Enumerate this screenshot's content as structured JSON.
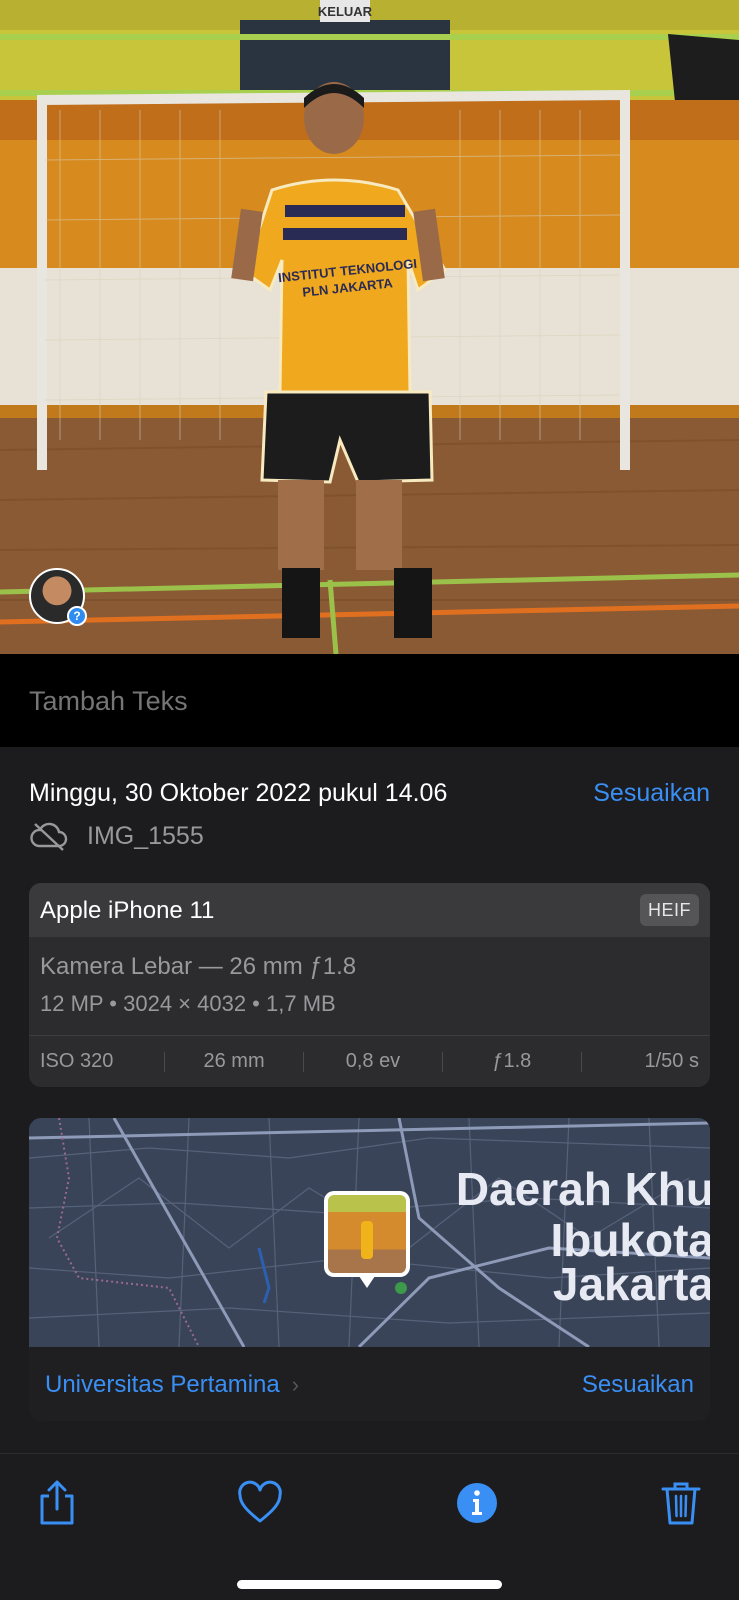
{
  "photo": {
    "exit_sign": "KELUAR",
    "face_badge_icon": "person-face-icon",
    "face_badge_mark": "?"
  },
  "caption": {
    "placeholder": "Tambah Teks"
  },
  "info": {
    "date": "Minggu, 30 Oktober 2022 pukul 14.06",
    "adjust_label": "Sesuaikan",
    "file_name": "IMG_1555",
    "cloud_icon": "icloud-off-icon"
  },
  "camera": {
    "model": "Apple iPhone 11",
    "format": "HEIF",
    "lens": "Kamera Lebar — 26 mm ƒ1.8",
    "specs": "12 MP  •  3024 × 4032  •  1,7 MB",
    "exif": {
      "iso": "ISO 320",
      "focal": "26 mm",
      "ev": "0,8 ev",
      "aperture": "ƒ1.8",
      "shutter": "1/50 s"
    }
  },
  "map": {
    "region_line1": "Daerah Khu",
    "region_line2": "Ibukota",
    "region_line3": "Jakarta",
    "place": "Universitas Pertamina",
    "adjust_label": "Sesuaikan"
  },
  "toolbar": {
    "share_icon": "share-icon",
    "favorite_icon": "heart-icon",
    "info_icon": "info-icon",
    "delete_icon": "trash-icon"
  },
  "colors": {
    "accent": "#3a8ff5",
    "panel": "#1c1c1e",
    "card": "#2c2c2e"
  }
}
